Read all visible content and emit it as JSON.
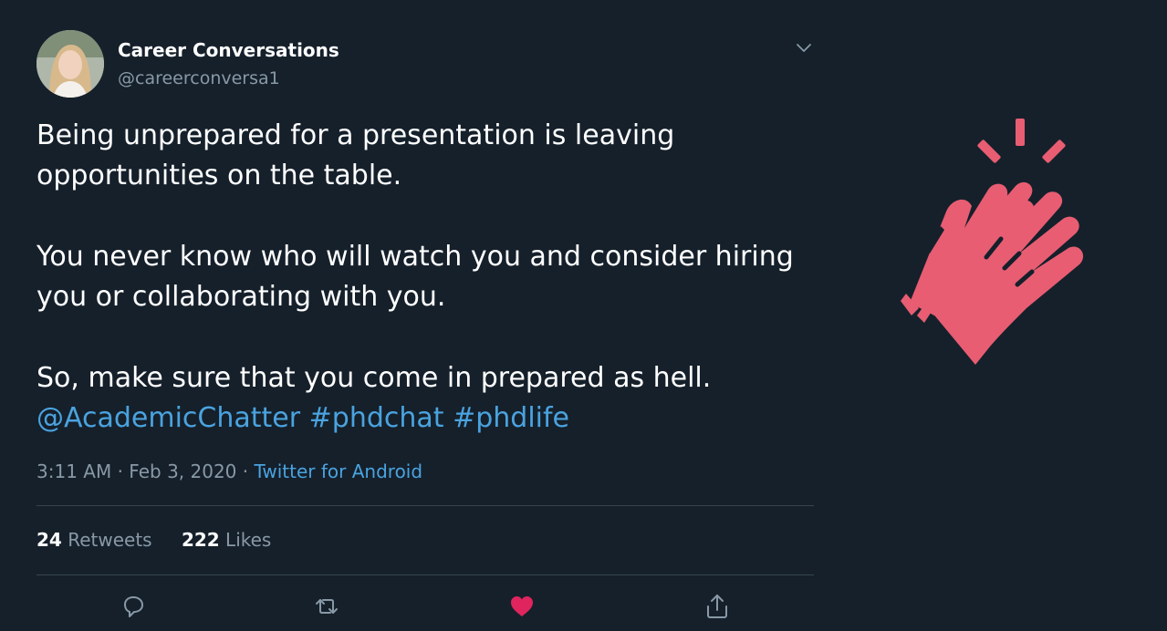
{
  "author": {
    "name": "Career Conversations",
    "handle": "@careerconversa1"
  },
  "tweet": {
    "paragraph1": [
      "Being unprepared for a presentation is leaving",
      "opportunities on the table."
    ],
    "paragraph2": [
      "You never know who will watch you and consider hiring",
      "you or collaborating with you."
    ],
    "paragraph3": "So, make sure that you come in prepared as hell.",
    "mention": "@AcademicChatter",
    "hashtags": [
      "#phdchat",
      "#phdlife"
    ]
  },
  "meta": {
    "time": "3:11 AM",
    "separator": "·",
    "date": "Feb 3, 2020",
    "source": "Twitter for Android"
  },
  "stats": {
    "retweets_count": "24",
    "retweets_label": "Retweets",
    "likes_count": "222",
    "likes_label": "Likes"
  },
  "icons": {
    "caret": "chevron-down-icon",
    "reply": "reply-icon",
    "retweet": "retweet-icon",
    "like": "heart-icon",
    "share": "share-icon",
    "decoration": "clapping-hands-icon"
  },
  "colors": {
    "background": "#15202b",
    "link": "#4aa3df",
    "muted": "#8899a6",
    "like": "#e0245e",
    "clap": "#e85d72"
  }
}
